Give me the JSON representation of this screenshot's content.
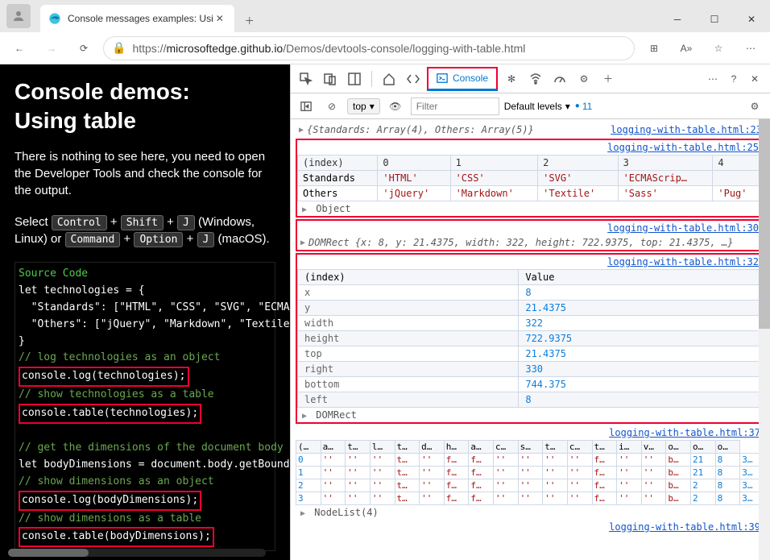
{
  "window": {
    "tab_title": "Console messages examples: Usi",
    "url_prefix": "https://",
    "url_host": "microsoftedge.github.io",
    "url_path": "/Demos/devtools-console/logging-with-table.html"
  },
  "page": {
    "h1_line1": "Console demos:",
    "h1_line2": "Using table",
    "intro": "There is nothing to see here, you need to open the Developer Tools and check the console for the output.",
    "select_text_1": "Select ",
    "select_text_2": " (Windows, Linux) or ",
    "select_text_3": " (macOS).",
    "keys": {
      "ctrl": "Control",
      "shift": "Shift",
      "j": "J",
      "cmd": "Command",
      "opt": "Option"
    },
    "code": {
      "title": "Source Code",
      "l1": "let technologies = {",
      "l2": "  \"Standards\": [\"HTML\", \"CSS\", \"SVG\", \"ECMASc",
      "l3": "  \"Others\": [\"jQuery\", \"Markdown\", \"Textile\",",
      "l4": "}",
      "c1": "// log technologies as an object",
      "h1": "console.log(technologies);",
      "c2": "// show technologies as a table",
      "h2": "console.table(technologies);",
      "c3": "// get the dimensions of the document body",
      "l5": "let bodyDimensions = document.body.getBoundin",
      "c4": "// show dimensions as an object",
      "h3": "console.log(bodyDimensions);",
      "c5": "// show dimensions as a table",
      "h4": "console.table(bodyDimensions);"
    }
  },
  "devtools": {
    "console_tab": "Console",
    "context": "top",
    "filter_placeholder": "Filter",
    "levels": "Default levels",
    "issue_count": "11"
  },
  "console": {
    "msg1": {
      "preview": "{Standards: Array(4), Others: Array(5)}",
      "src": "logging-with-table.html:23"
    },
    "table1": {
      "src": "logging-with-table.html:25",
      "headers": [
        "(index)",
        "0",
        "1",
        "2",
        "3",
        "4"
      ],
      "rows": [
        {
          "k": "Standards",
          "v": [
            "'HTML'",
            "'CSS'",
            "'SVG'",
            "'ECMAScrip…",
            ""
          ]
        },
        {
          "k": "Others",
          "v": [
            "'jQuery'",
            "'Markdown'",
            "'Textile'",
            "'Sass'",
            "'Pug'"
          ]
        }
      ],
      "summary_label": "Object"
    },
    "msg2": {
      "prefix": "DOMRect ",
      "preview": "{x: 8, y: 21.4375, width: 322, height: 722.9375, top: 21.4375, …}",
      "src": "logging-with-table.html:30"
    },
    "table2": {
      "src": "logging-with-table.html:32",
      "headers": [
        "(index)",
        "Value"
      ],
      "rows": [
        {
          "k": "x",
          "v": "8"
        },
        {
          "k": "y",
          "v": "21.4375"
        },
        {
          "k": "width",
          "v": "322"
        },
        {
          "k": "height",
          "v": "722.9375"
        },
        {
          "k": "top",
          "v": "21.4375"
        },
        {
          "k": "right",
          "v": "330"
        },
        {
          "k": "bottom",
          "v": "744.375"
        },
        {
          "k": "left",
          "v": "8"
        }
      ],
      "summary_label": "DOMRect"
    },
    "table3": {
      "src": "logging-with-table.html:37",
      "headers": [
        "(…",
        "a…",
        "t…",
        "l…",
        "t…",
        "d…",
        "h…",
        "a…",
        "c…",
        "s…",
        "t…",
        "c…",
        "t…",
        "i…",
        "v…",
        "o…",
        "o…",
        "o…"
      ],
      "rows": [
        [
          "0",
          "''",
          "''",
          "''",
          "t…",
          "''",
          "f…",
          "f…",
          "''",
          "''",
          "''",
          "''",
          "f…",
          "''",
          "''",
          "b…",
          "21",
          "8",
          "3…"
        ],
        [
          "1",
          "''",
          "''",
          "''",
          "t…",
          "''",
          "f…",
          "f…",
          "''",
          "''",
          "''",
          "''",
          "f…",
          "''",
          "''",
          "b…",
          "21",
          "8",
          "3…"
        ],
        [
          "2",
          "''",
          "''",
          "''",
          "t…",
          "''",
          "f…",
          "f…",
          "''",
          "''",
          "''",
          "''",
          "f…",
          "''",
          "''",
          "b…",
          "2",
          "8",
          "3…"
        ],
        [
          "3",
          "''",
          "''",
          "''",
          "t…",
          "''",
          "f…",
          "f…",
          "''",
          "''",
          "''",
          "''",
          "f…",
          "''",
          "''",
          "b…",
          "2",
          "8",
          "3…"
        ]
      ],
      "summary_label": "NodeList(4)",
      "footer_src": "logging-with-table.html:39"
    }
  }
}
